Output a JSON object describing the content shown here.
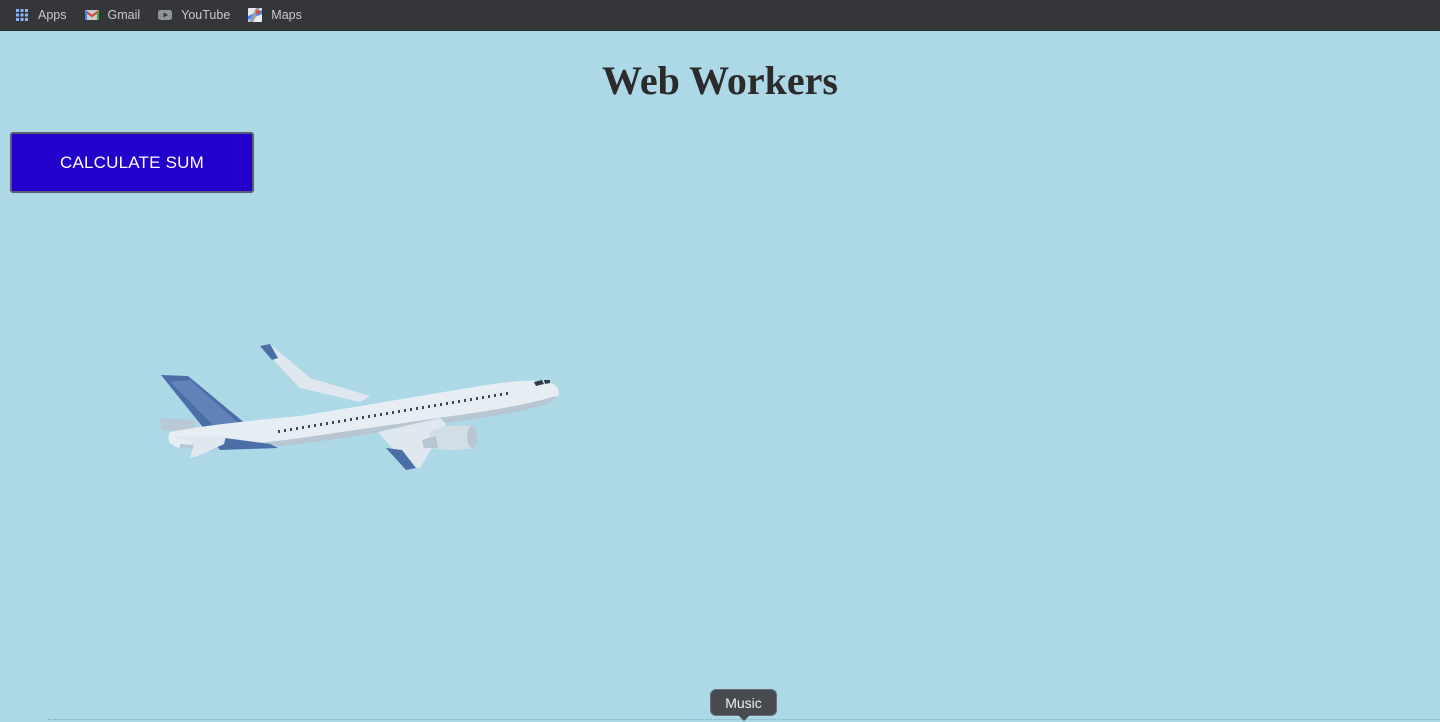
{
  "bookmarks": [
    {
      "label": "Apps",
      "icon": "apps-grid-icon"
    },
    {
      "label": "Gmail",
      "icon": "gmail-icon"
    },
    {
      "label": "YouTube",
      "icon": "youtube-icon"
    },
    {
      "label": "Maps",
      "icon": "maps-icon"
    }
  ],
  "page": {
    "title": "Web Workers",
    "button_label": "CALCULATE SUM",
    "background_color": "#add8e6",
    "button_color": "#2300cc"
  },
  "dock": {
    "tooltip": "Music"
  },
  "illustration": {
    "icon": "airplane-icon"
  }
}
